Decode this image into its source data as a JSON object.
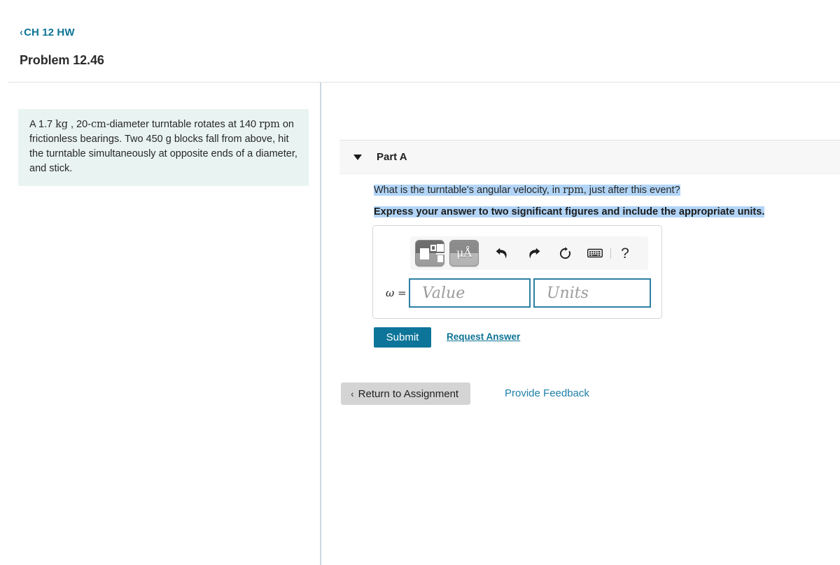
{
  "header": {
    "back_chevron": "‹",
    "breadcrumb_label": "CH 12 HW",
    "page_title": "Problem 12.46"
  },
  "problem": {
    "text_1": "A 1.7 ",
    "unit_kg": "kg",
    "text_2": " , 20-",
    "unit_cm": "cm",
    "text_3": "-diameter turntable rotates at 140 ",
    "unit_rpm": "rpm",
    "text_4": " on frictionless bearings. Two 450 g blocks fall from above, hit the turntable simultaneously at opposite ends of a diameter, and stick."
  },
  "part": {
    "caret": "▼",
    "label": "Part A",
    "question_pre": "What is the turntable's angular velocity, in ",
    "question_unit": "rpm",
    "question_post": ", just after this event?",
    "instruction": "Express your answer to two significant figures and include the appropriate units."
  },
  "answer": {
    "toolbar": {
      "template_button_name": "math-template",
      "units_button_label": "μÅ",
      "undo_glyph": "⬅",
      "redo_glyph": "➡",
      "reset_glyph": "↺",
      "keyboard_glyph": "⌨",
      "help_glyph": "?"
    },
    "variable_label": "ω =",
    "value_placeholder": "Value",
    "value_current": "",
    "units_placeholder": "Units",
    "units_current": ""
  },
  "actions": {
    "submit_label": "Submit",
    "request_answer_label": "Request Answer",
    "return_chevron": "‹",
    "return_label": "Return to Assignment",
    "feedback_label": "Provide Feedback"
  },
  "colors": {
    "accent_teal": "#0E7496",
    "submit_teal": "#0D7599",
    "problem_bg": "#E9F4F2",
    "selection_blue": "#B2D5F7",
    "field_border": "#2C7FA3",
    "part_header_bg": "#F7F7F7",
    "divider": "#CCD8E2"
  }
}
